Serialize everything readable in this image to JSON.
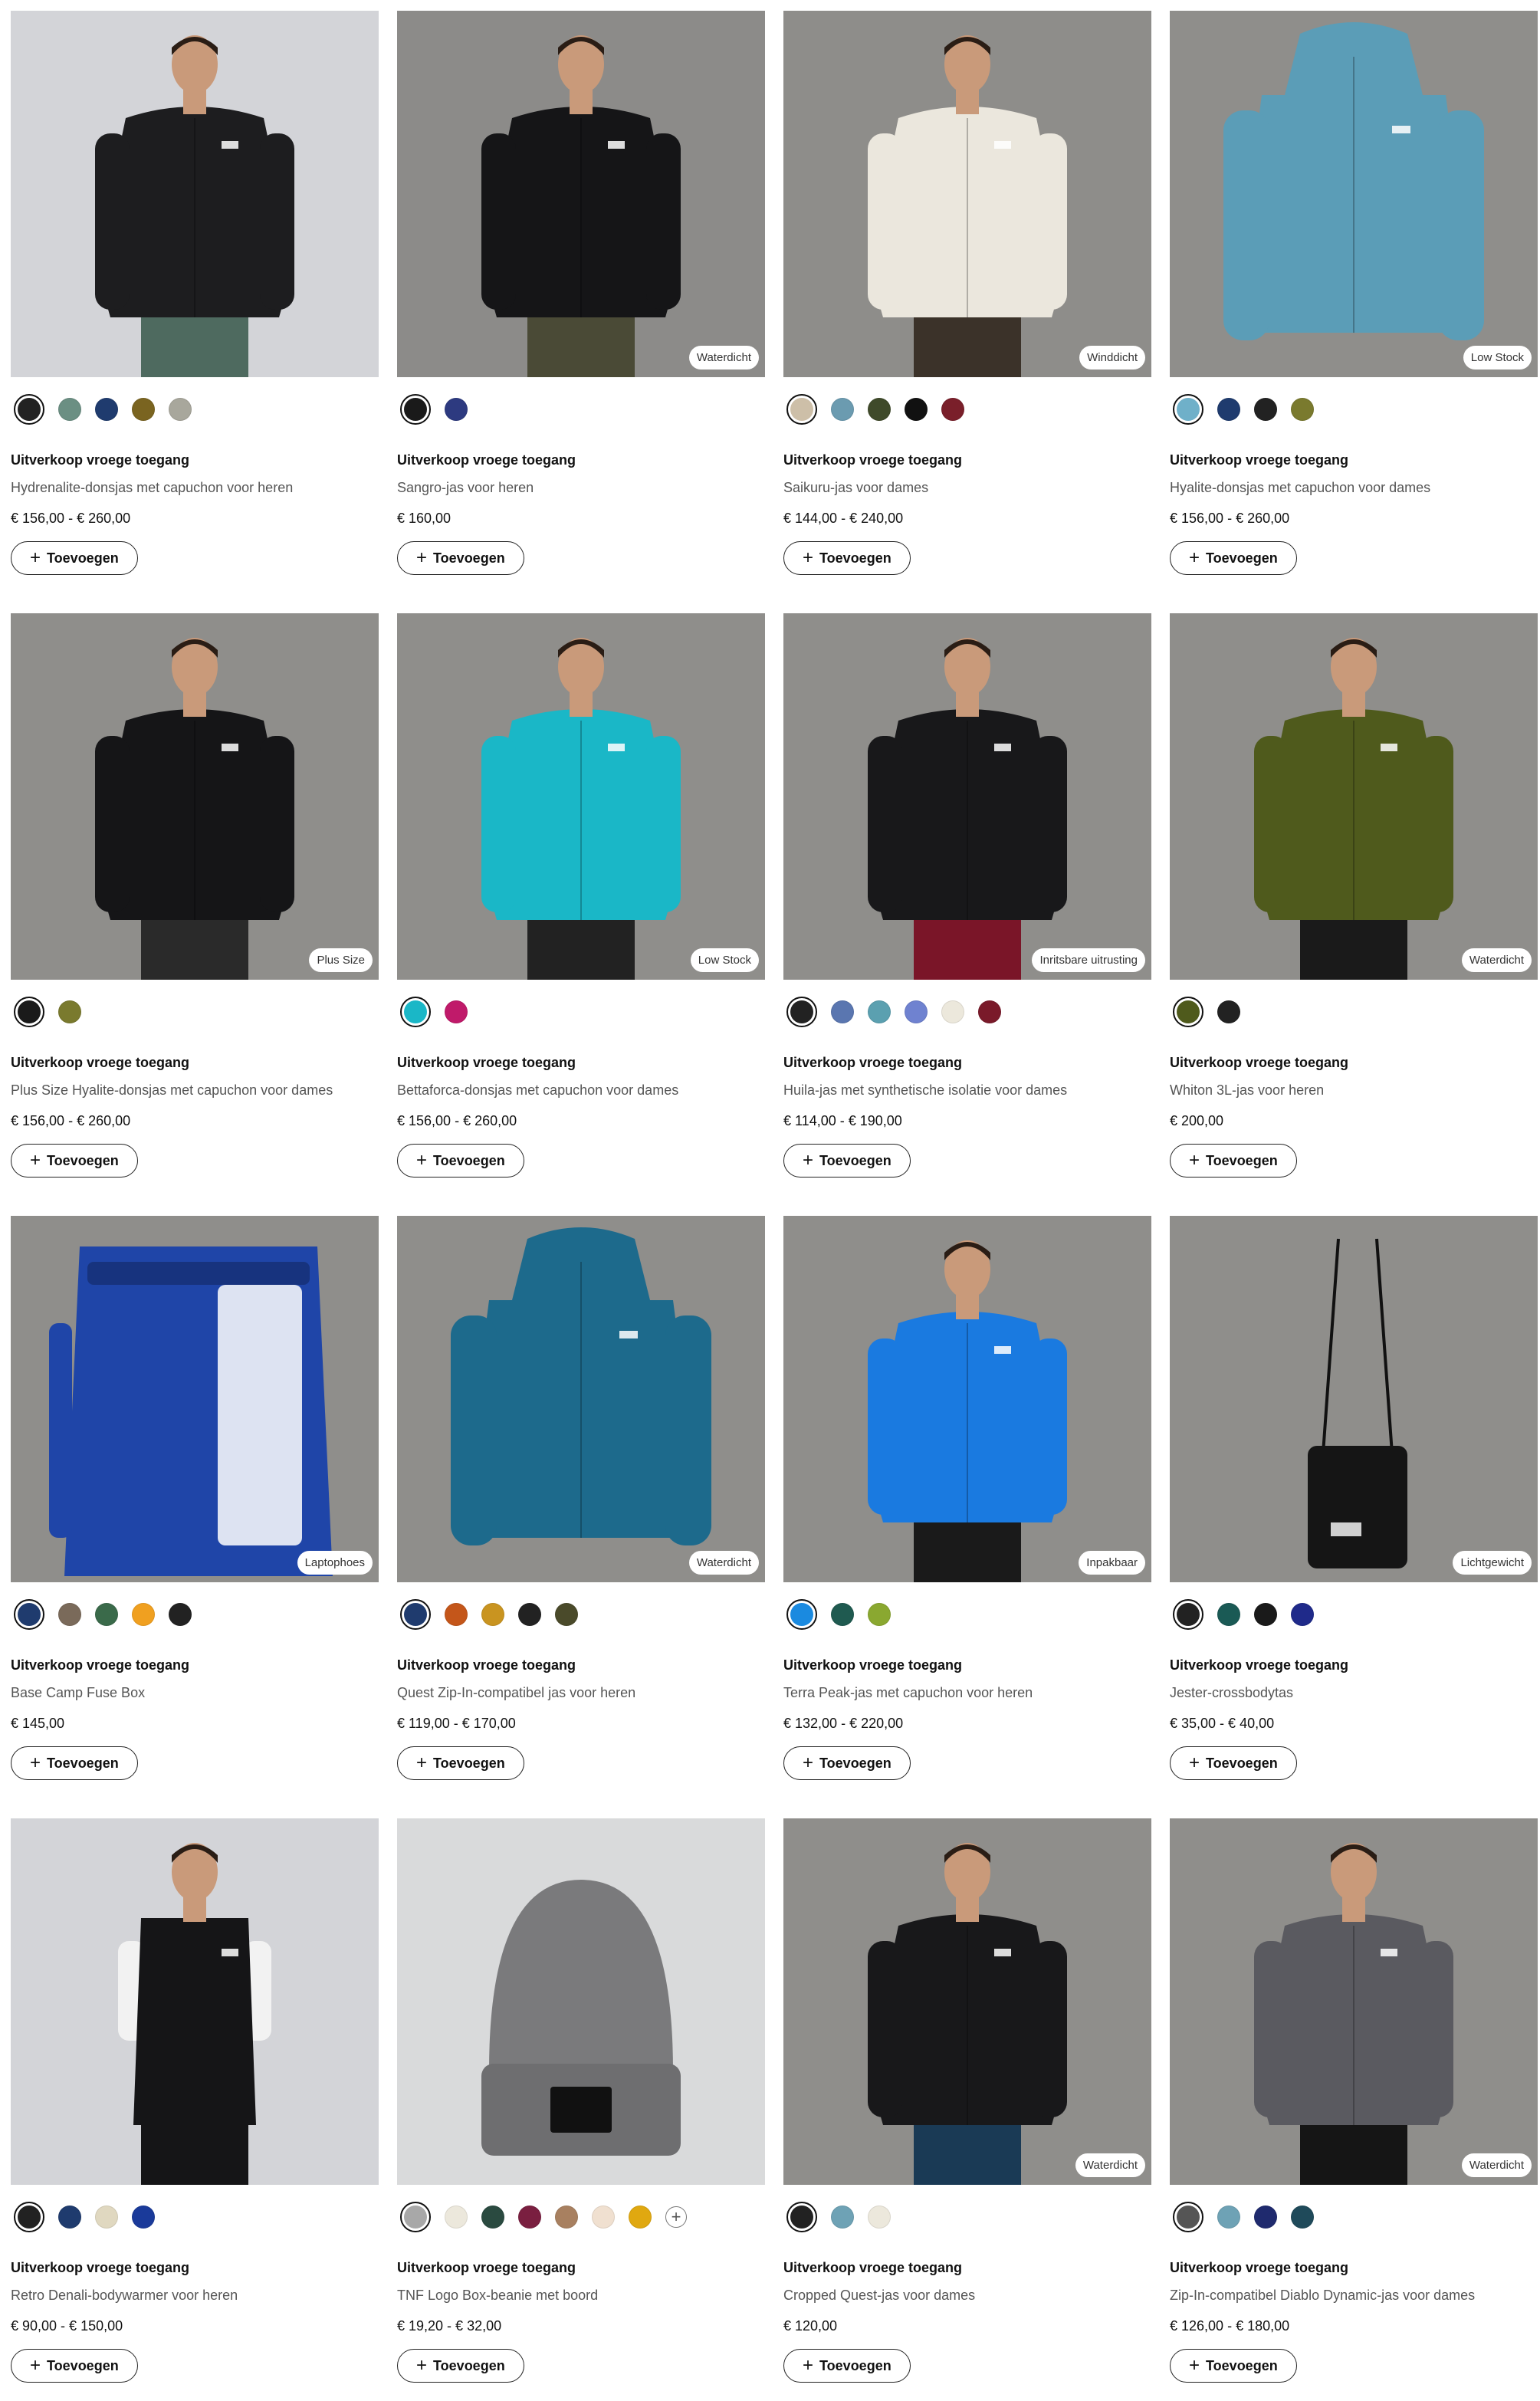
{
  "add_label": "Toevoegen",
  "products": [
    {
      "tag": "Uitverkoop vroege toegang",
      "name": "Hydrenalite-donsjas met capuchon voor heren",
      "price": "€ 156,00 - € 260,00",
      "badge": "",
      "bg": "#d3d4d8",
      "main": "#1d1d1f",
      "lower": "#4e6a5f",
      "type": "person-jacket",
      "colors": [
        "#222222",
        "#6b8f83",
        "#1f3b6e",
        "#7a6420",
        "#a8a79c"
      ],
      "more": false
    },
    {
      "tag": "Uitverkoop vroege toegang",
      "name": "Sangro-jas voor heren",
      "price": "€ 160,00",
      "badge": "Waterdicht",
      "bg": "#8c8b89",
      "main": "#151517",
      "lower": "#4a4a36",
      "type": "person-jacket",
      "colors": [
        "#1a1a1a",
        "#2d3a80"
      ],
      "more": false
    },
    {
      "tag": "Uitverkoop vroege toegang",
      "name": "Saikuru-jas voor dames",
      "price": "€ 144,00 - € 240,00",
      "badge": "Winddicht",
      "bg": "#8e8d8a",
      "main": "#ebe7dd",
      "lower": "#3b3229",
      "type": "person-jacket",
      "colors": [
        "#cdbfa8",
        "#6b9bb0",
        "#3f4a2a",
        "#111111",
        "#7a1f2a"
      ],
      "more": false
    },
    {
      "tag": "Uitverkoop vroege toegang",
      "name": "Hyalite-donsjas met capuchon voor dames",
      "price": "€ 156,00 - € 260,00",
      "badge": "Low Stock",
      "bg": "#8f8e8b",
      "main": "#5b9db7",
      "lower": "#5b9db7",
      "type": "jacket-only",
      "colors": [
        "#6fb0c9",
        "#1f3b6e",
        "#222222",
        "#7a7a2e"
      ],
      "more": false
    },
    {
      "tag": "Uitverkoop vroege toegang",
      "name": "Plus Size Hyalite-donsjas met capuchon voor dames",
      "price": "€ 156,00 - € 260,00",
      "badge": "Plus Size",
      "bg": "#8f8e8b",
      "main": "#151517",
      "lower": "#2a2a2a",
      "type": "person-jacket",
      "colors": [
        "#1a1a1a",
        "#7a7a2e"
      ],
      "more": false
    },
    {
      "tag": "Uitverkoop vroege toegang",
      "name": "Bettaforca-donsjas met capuchon voor dames",
      "price": "€ 156,00 - € 260,00",
      "badge": "Low Stock",
      "bg": "#8f8e8b",
      "main": "#1ab7c7",
      "lower": "#222222",
      "type": "person-jacket",
      "colors": [
        "#1ab7c7",
        "#c01a6a"
      ],
      "more": false
    },
    {
      "tag": "Uitverkoop vroege toegang",
      "name": "Huila-jas met synthetische isolatie voor dames",
      "price": "€ 114,00 - € 190,00",
      "badge": "Inritsbare uitrusting",
      "bg": "#8f8e8b",
      "main": "#18181a",
      "lower": "#7a1528",
      "type": "person-jacket",
      "colors": [
        "#222222",
        "#5a76b0",
        "#5ba0b0",
        "#6f82d0",
        "#ece8dc",
        "#7a1a2a"
      ],
      "more": false
    },
    {
      "tag": "Uitverkoop vroege toegang",
      "name": "Whiton 3L-jas voor heren",
      "price": "€ 200,00",
      "badge": "Waterdicht",
      "bg": "#8f8e8b",
      "main": "#4f5a1c",
      "lower": "#1a1a1a",
      "type": "person-jacket",
      "colors": [
        "#4f5a1c",
        "#222222"
      ],
      "more": false
    },
    {
      "tag": "Uitverkoop vroege toegang",
      "name": "Base Camp Fuse Box",
      "price": "€ 145,00",
      "badge": "Laptophoes",
      "bg": "#8f8e8b",
      "main": "#1f45a8",
      "lower": "#1f45a8",
      "type": "backpack",
      "colors": [
        "#1f3b6e",
        "#7a6a5a",
        "#3a6a4a",
        "#f0a020",
        "#222222"
      ],
      "more": false
    },
    {
      "tag": "Uitverkoop vroege toegang",
      "name": "Quest Zip-In-compatibel jas voor heren",
      "price": "€ 119,00 - € 170,00",
      "badge": "Waterdicht",
      "bg": "#8f8e8b",
      "main": "#1d6a8c",
      "lower": "#1d6a8c",
      "type": "jacket-only",
      "colors": [
        "#1f3b6e",
        "#c4561a",
        "#c99420",
        "#222222",
        "#4a4a2a"
      ],
      "more": false
    },
    {
      "tag": "Uitverkoop vroege toegang",
      "name": "Terra Peak-jas met capuchon voor heren",
      "price": "€ 132,00 - € 220,00",
      "badge": "Inpakbaar",
      "bg": "#8f8e8b",
      "main": "#1a7ae0",
      "lower": "#1a1a1a",
      "type": "person-jacket",
      "colors": [
        "#1a8ae0",
        "#1f5a50",
        "#8aa830"
      ],
      "more": false
    },
    {
      "tag": "Uitverkoop vroege toegang",
      "name": "Jester-crossbodytas",
      "price": "€ 35,00 - € 40,00",
      "badge": "Lichtgewicht",
      "bg": "#8f8e8b",
      "main": "#151515",
      "lower": "#151515",
      "type": "crossbody",
      "colors": [
        "#222222",
        "#1a5a55",
        "#1a1a1a",
        "#1f2a8a"
      ],
      "more": false
    },
    {
      "tag": "Uitverkoop vroege toegang",
      "name": "Retro Denali-bodywarmer voor heren",
      "price": "€ 90,00 - € 150,00",
      "badge": "",
      "bg": "#d3d4d8",
      "main": "#151517",
      "lower": "#151517",
      "type": "person-vest",
      "colors": [
        "#222222",
        "#1f3b6e",
        "#e0d8c0",
        "#1a3a9a"
      ],
      "more": false
    },
    {
      "tag": "Uitverkoop vroege toegang",
      "name": "TNF Logo Box-beanie met boord",
      "price": "€ 19,20 - € 32,00",
      "badge": "",
      "bg": "#d9dadb",
      "main": "#7a7a7c",
      "lower": "#7a7a7c",
      "type": "beanie",
      "colors": [
        "#a8a8a8",
        "#ece8dc",
        "#2a4a40",
        "#7a1f40",
        "#a88060",
        "#f0e0d0",
        "#e0a810"
      ],
      "more": true
    },
    {
      "tag": "Uitverkoop vroege toegang",
      "name": "Cropped Quest-jas voor dames",
      "price": "€ 120,00",
      "badge": "Waterdicht",
      "bg": "#8f8e8b",
      "main": "#18181a",
      "lower": "#1a3a55",
      "type": "person-jacket",
      "colors": [
        "#222222",
        "#6ea2b5",
        "#ece8dc"
      ],
      "more": false
    },
    {
      "tag": "Uitverkoop vroege toegang",
      "name": "Zip-In-compatibel Diablo Dynamic-jas voor dames",
      "price": "€ 126,00 - € 180,00",
      "badge": "Waterdicht",
      "bg": "#8f8e8b",
      "main": "#5a5a60",
      "lower": "#151515",
      "type": "person-jacket",
      "colors": [
        "#555555",
        "#6ea2b5",
        "#1f2a6e",
        "#1f4a5a"
      ],
      "more": false
    }
  ]
}
